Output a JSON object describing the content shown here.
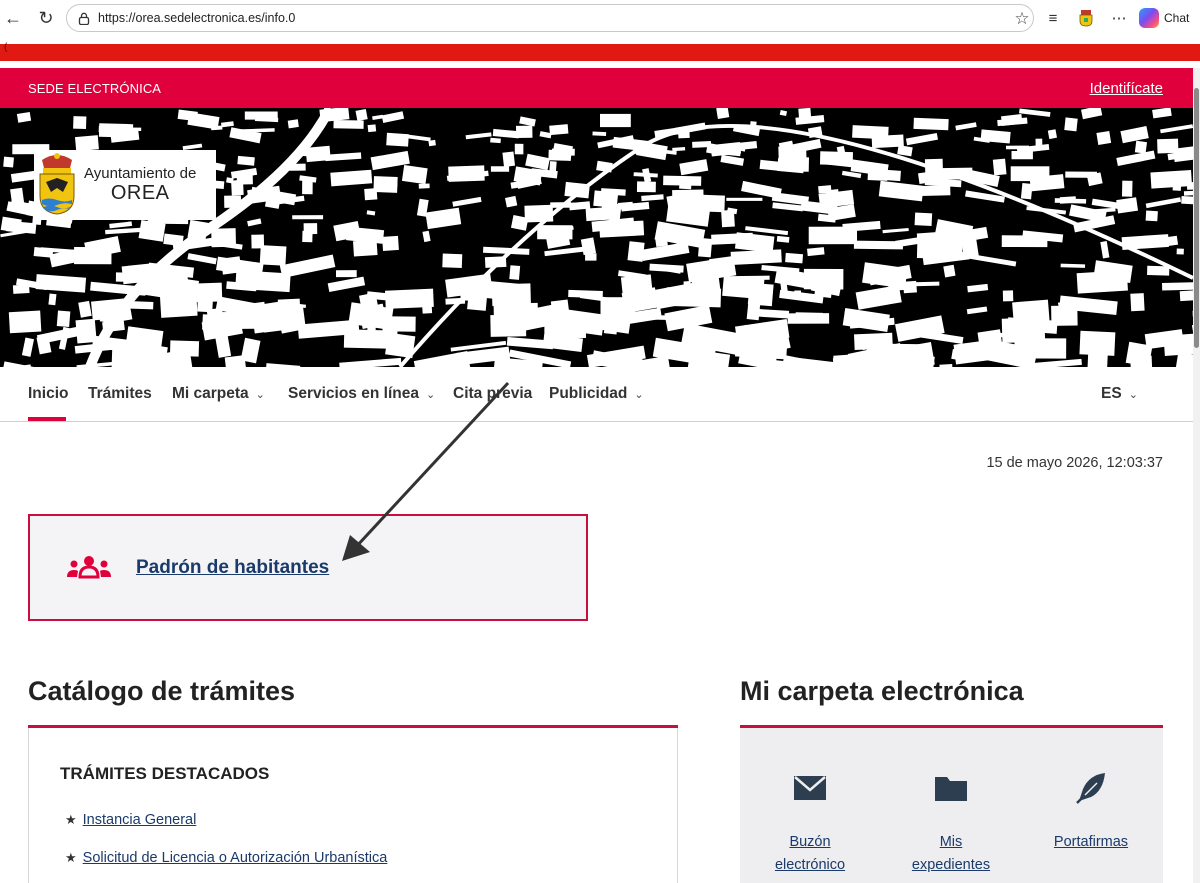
{
  "browser": {
    "url": "https://orea.sedelectronica.es/info.0",
    "chat_label": "Chat",
    "small_char": "("
  },
  "header": {
    "sede_label": "SEDE ELECTRÓNICA",
    "login_label": "Identifícate",
    "brand_color": "#e0003c"
  },
  "logo": {
    "line1": "Ayuntamiento de",
    "line2": "OREA"
  },
  "nav": {
    "items": [
      {
        "label": "Inicio",
        "dropdown": false,
        "active": true
      },
      {
        "label": "Trámites",
        "dropdown": false
      },
      {
        "label": "Mi carpeta",
        "dropdown": true
      },
      {
        "label": "Servicios en línea",
        "dropdown": true
      },
      {
        "label": "Cita previa",
        "dropdown": false
      },
      {
        "label": "Publicidad",
        "dropdown": true
      }
    ],
    "language": "ES"
  },
  "datetime": "15 de mayo 2026, 12:03:37",
  "featured": {
    "label": "Padrón de habitantes",
    "icon": "group-icon"
  },
  "catalog": {
    "title": "Catálogo de trámites",
    "subtitle": "TRÁMITES DESTACADOS",
    "items": [
      "Instancia General",
      "Solicitud de Licencia o Autorización Urbanística"
    ]
  },
  "carpeta": {
    "title": "Mi carpeta electrónica",
    "items": [
      {
        "line1": "Buzón",
        "line2": "electrónico",
        "icon": "envelope-icon"
      },
      {
        "line1": "Mis",
        "line2": "expedientes",
        "icon": "folder-icon"
      },
      {
        "line1": "Portafirmas",
        "line2": "",
        "icon": "pen-nib-icon"
      }
    ]
  }
}
